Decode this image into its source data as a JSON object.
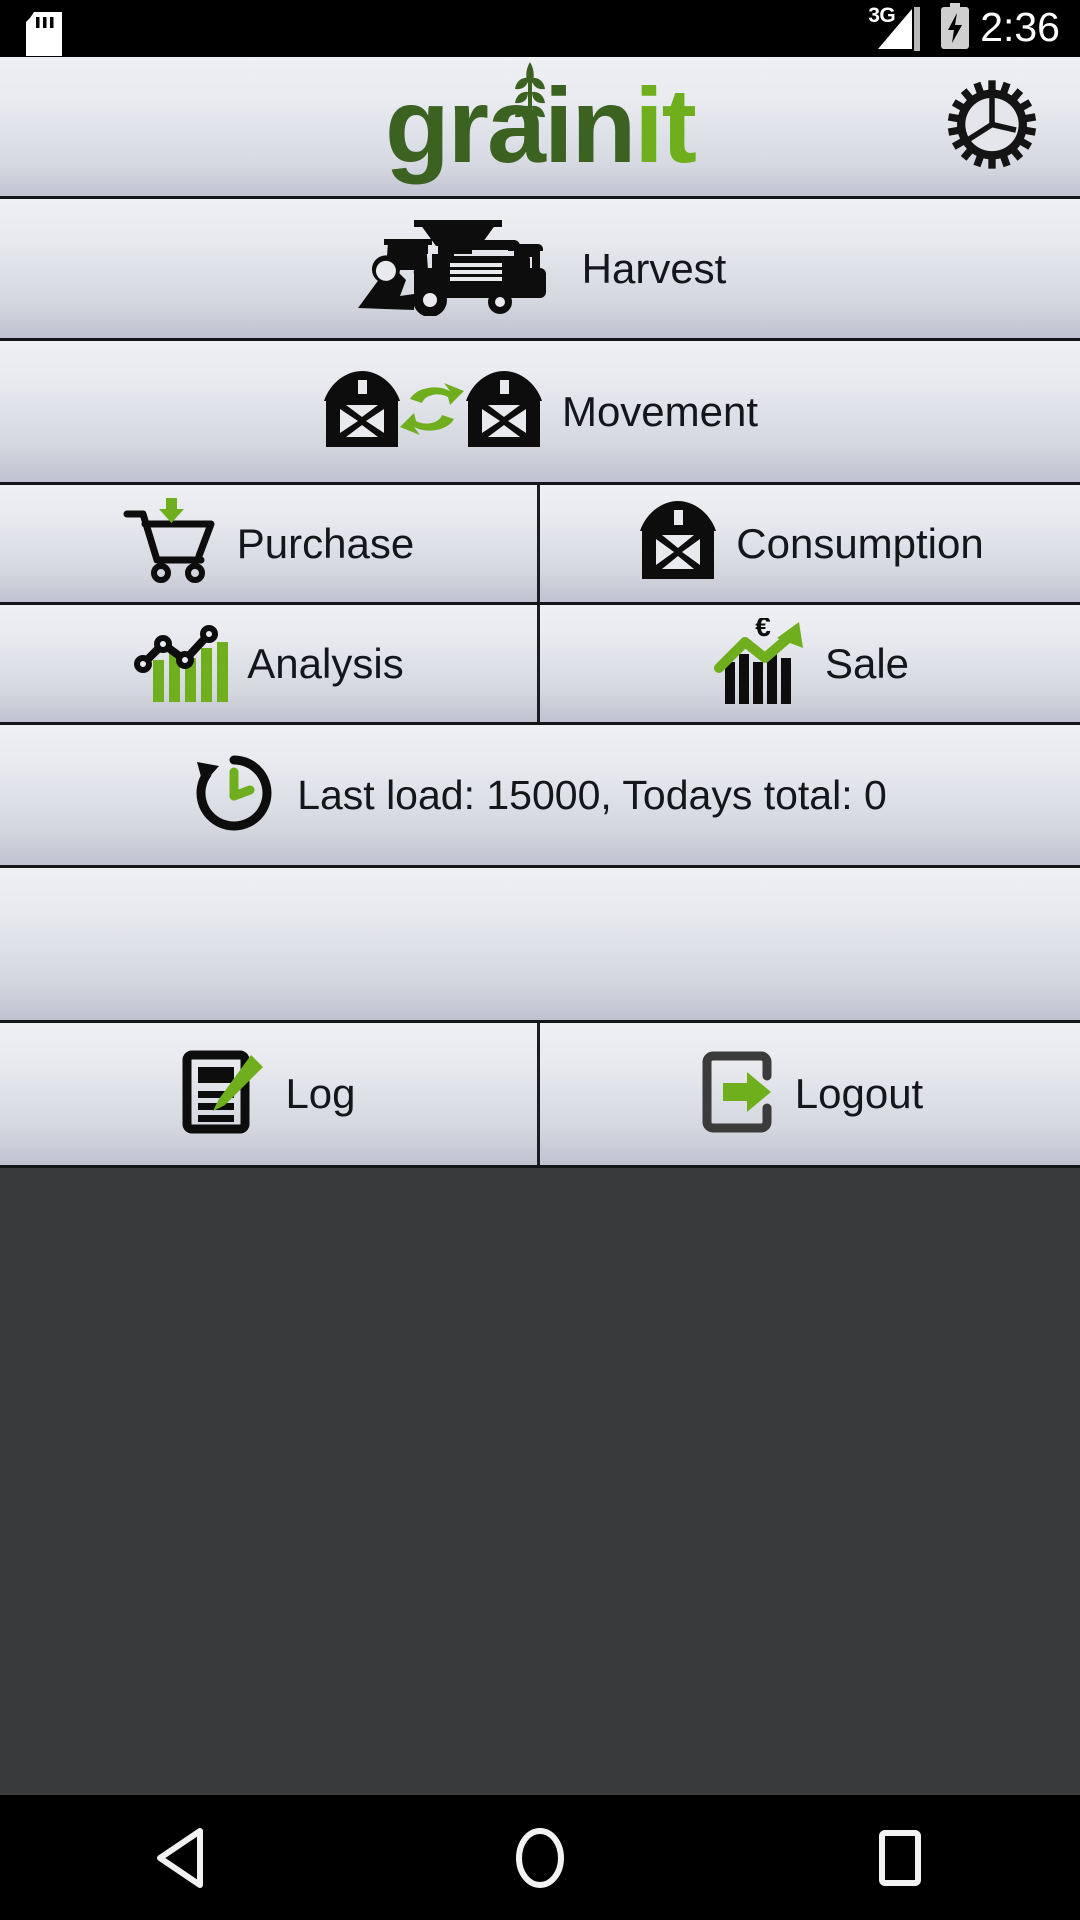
{
  "status_bar": {
    "sd_card_icon": "sd-card-icon",
    "network_label": "3G",
    "signal_icon": "signal-bars-icon",
    "battery_icon": "battery-charging-icon",
    "time": "2:36"
  },
  "header": {
    "logo_part1": "grain",
    "logo_part2": "it",
    "wheat_icon": "wheat-stalk-icon",
    "settings_icon": "gear-icon"
  },
  "menu": {
    "harvest": {
      "label": "Harvest",
      "icon": "combine-harvester-icon"
    },
    "movement": {
      "label": "Movement",
      "icon": "barn-exchange-icon"
    },
    "purchase": {
      "label": "Purchase",
      "icon": "shopping-cart-down-arrow-icon"
    },
    "consumption": {
      "label": "Consumption",
      "icon": "barn-icon"
    },
    "analysis": {
      "label": "Analysis",
      "icon": "bar-line-chart-icon"
    },
    "sale": {
      "label": "Sale",
      "icon": "rising-chart-euro-icon"
    }
  },
  "status_row": {
    "text": "Last load: 15000, Todays total: 0",
    "icon": "history-clock-icon",
    "last_load": "15000",
    "todays_total": "0"
  },
  "footer": {
    "log": {
      "label": "Log",
      "icon": "document-pencil-icon"
    },
    "logout": {
      "label": "Logout",
      "icon": "exit-door-arrow-icon"
    }
  },
  "nav_bar": {
    "back": "back-triangle-icon",
    "home": "home-circle-icon",
    "recents": "recents-square-icon"
  },
  "colors": {
    "brand_dark_green": "#3c6222",
    "brand_green": "#6faf1e",
    "panel_light": "#eef0f3",
    "panel_dark": "#c0c2d0",
    "text": "#14161a",
    "empty_area": "#383a3b"
  }
}
